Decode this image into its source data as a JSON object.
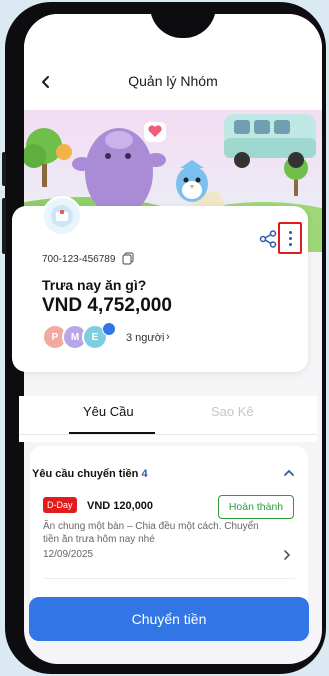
{
  "header": {
    "title": "Quản lý Nhóm"
  },
  "group": {
    "account_number": "700-123-456789",
    "name": "Trưa nay ăn gì?",
    "balance": "VND 4,752,000",
    "members_count": "3 người",
    "member_avatars": [
      "P",
      "M",
      "E"
    ]
  },
  "tabs": [
    {
      "label": "Yêu Cầu",
      "active": true
    },
    {
      "label": "Sao Kê",
      "active": false
    }
  ],
  "requests": {
    "title": "Yêu cầu chuyển tiền",
    "count": "4",
    "items": [
      {
        "badge": "D-Day",
        "amount": "VND 120,000",
        "status": "Hoàn thành",
        "description": "Ăn chung một bàn – Chia đều một cách. Chuyển tiền ăn trưa hôm nay nhé",
        "date": "12/09/2025"
      }
    ]
  },
  "cta": {
    "label": "Chuyển tiền"
  },
  "colors": {
    "accent": "#3276e6",
    "danger": "#e11c1c",
    "success": "#2e9a3c",
    "link": "#2f5aa8"
  }
}
